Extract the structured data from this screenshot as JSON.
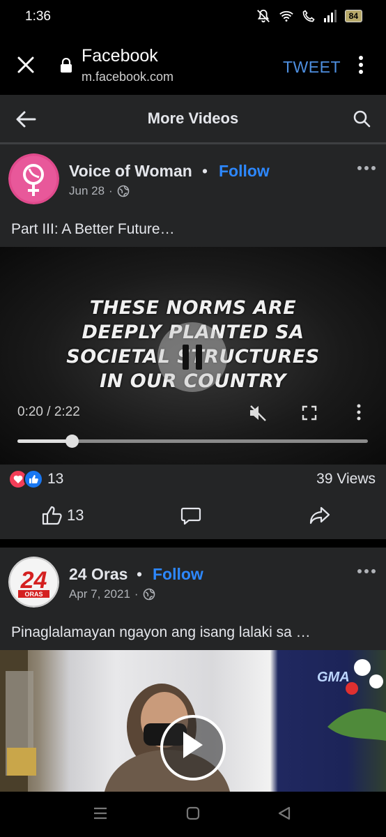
{
  "status_bar": {
    "time": "1:36",
    "battery": "84"
  },
  "browser": {
    "title": "Facebook",
    "url": "m.facebook.com",
    "tweet_label": "TWEET"
  },
  "header": {
    "title": "More Videos"
  },
  "posts": [
    {
      "author": "Voice of Woman",
      "follow_label": "Follow",
      "date": "Jun 28",
      "text": "Part III: A Better Future…",
      "video": {
        "caption_lines": [
          "THESE NORMS ARE",
          "DEEPLY PLANTED SA",
          "SOCIETAL STRUCTURES",
          "IN OUR COUNTRY"
        ],
        "time": "0:20 / 2:22",
        "progress": 0.155
      },
      "reaction_count": "13",
      "views": "39 Views",
      "like_count": "13"
    },
    {
      "author": "24 Oras",
      "follow_label": "Follow",
      "date": "Apr 7, 2021",
      "text": "Pinaglalamayan ngayon ang isang lalaki sa …",
      "video": {
        "watermark": "GMA"
      }
    }
  ],
  "colors": {
    "accent": "#2d88ff",
    "tweet": "#4e8fe0",
    "card_bg": "#242526"
  }
}
